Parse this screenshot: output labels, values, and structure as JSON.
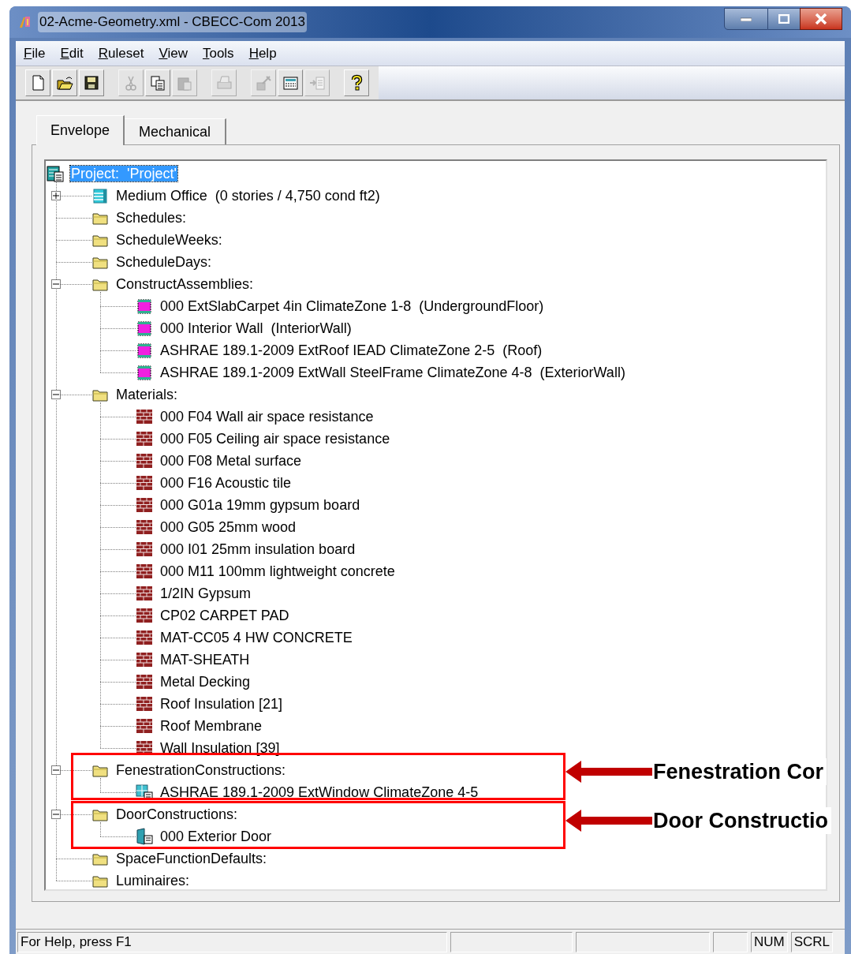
{
  "window": {
    "title": "02-Acme-Geometry.xml - CBECC-Com 2013"
  },
  "menu": [
    "File",
    "Edit",
    "Ruleset",
    "View",
    "Tools",
    "Help"
  ],
  "toolbar": [
    {
      "kind": "new",
      "disabled": false
    },
    {
      "kind": "open",
      "disabled": false
    },
    {
      "kind": "save",
      "disabled": false
    },
    {
      "kind": "cut",
      "disabled": true
    },
    {
      "kind": "copy",
      "disabled": false
    },
    {
      "kind": "paste",
      "disabled": true
    },
    {
      "kind": "print",
      "disabled": true
    },
    {
      "kind": "wizard",
      "disabled": true
    },
    {
      "kind": "calculator",
      "disabled": false
    },
    {
      "kind": "import",
      "disabled": true
    },
    {
      "kind": "help",
      "disabled": false
    }
  ],
  "tabs": [
    {
      "label": "Envelope",
      "selected": true
    },
    {
      "label": "Mechanical",
      "selected": false
    }
  ],
  "tree": {
    "label": "Project:  'Project'",
    "kind": "project",
    "selected": true,
    "children": [
      {
        "label": "Medium Office  (0 stories / 4,750 cond ft2)",
        "kind": "building",
        "selected": false,
        "expanded": false
      },
      {
        "label": "Schedules:",
        "kind": "folder",
        "selected": false
      },
      {
        "label": "ScheduleWeeks:",
        "kind": "folder",
        "selected": false
      },
      {
        "label": "ScheduleDays:",
        "kind": "folder",
        "selected": false
      },
      {
        "label": "ConstructAssemblies:",
        "kind": "folder",
        "selected": false,
        "expanded": true,
        "children": [
          {
            "label": "000 ExtSlabCarpet 4in ClimateZone 1-8  (UndergroundFloor)",
            "kind": "assembly",
            "selected": false
          },
          {
            "label": "000 Interior Wall  (InteriorWall)",
            "kind": "assembly",
            "selected": false
          },
          {
            "label": "ASHRAE 189.1-2009 ExtRoof IEAD ClimateZone 2-5  (Roof)",
            "kind": "assembly",
            "selected": false
          },
          {
            "label": "ASHRAE 189.1-2009 ExtWall SteelFrame ClimateZone 4-8  (ExteriorWall)",
            "kind": "assembly",
            "selected": false
          }
        ]
      },
      {
        "label": "Materials:",
        "kind": "folder",
        "selected": false,
        "expanded": true,
        "children": [
          {
            "label": "000 F04 Wall air space resistance",
            "kind": "material",
            "selected": false
          },
          {
            "label": "000 F05 Ceiling air space resistance",
            "kind": "material",
            "selected": false
          },
          {
            "label": "000 F08 Metal surface",
            "kind": "material",
            "selected": false
          },
          {
            "label": "000 F16 Acoustic tile",
            "kind": "material",
            "selected": false
          },
          {
            "label": "000 G01a 19mm gypsum board",
            "kind": "material",
            "selected": false
          },
          {
            "label": "000 G05 25mm wood",
            "kind": "material",
            "selected": false
          },
          {
            "label": "000 I01 25mm insulation board",
            "kind": "material",
            "selected": false
          },
          {
            "label": "000 M11 100mm lightweight concrete",
            "kind": "material",
            "selected": false
          },
          {
            "label": "1/2IN Gypsum",
            "kind": "material",
            "selected": false
          },
          {
            "label": "CP02 CARPET PAD",
            "kind": "material",
            "selected": false
          },
          {
            "label": "MAT-CC05 4 HW CONCRETE",
            "kind": "material",
            "selected": false
          },
          {
            "label": "MAT-SHEATH",
            "kind": "material",
            "selected": false
          },
          {
            "label": "Metal Decking",
            "kind": "material",
            "selected": false
          },
          {
            "label": "Roof Insulation [21]",
            "kind": "material",
            "selected": false
          },
          {
            "label": "Roof Membrane",
            "kind": "material",
            "selected": false
          },
          {
            "label": "Wall Insulation [39]",
            "kind": "material",
            "selected": false
          }
        ]
      },
      {
        "label": "FenestrationConstructions:",
        "kind": "folder",
        "selected": false,
        "expanded": true,
        "children": [
          {
            "label": "ASHRAE 189.1-2009 ExtWindow ClimateZone 4-5",
            "kind": "window",
            "selected": false
          }
        ]
      },
      {
        "label": "DoorConstructions:",
        "kind": "folder",
        "selected": false,
        "expanded": true,
        "children": [
          {
            "label": "000 Exterior Door",
            "kind": "door",
            "selected": false
          }
        ]
      },
      {
        "label": "SpaceFunctionDefaults:",
        "kind": "folder",
        "selected": false
      },
      {
        "label": "Luminaires:",
        "kind": "folder",
        "selected": false
      }
    ]
  },
  "annotations": [
    {
      "label": "Fenestration Cor"
    },
    {
      "label": "Door Constructio"
    }
  ],
  "status_bar": {
    "message": "For Help, press F1",
    "indicators": [
      "NUM",
      "SCRL"
    ]
  }
}
